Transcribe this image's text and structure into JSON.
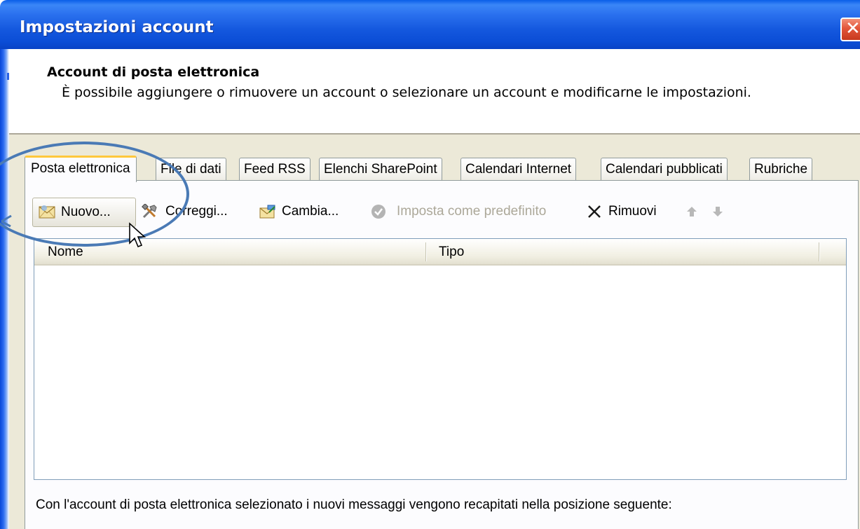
{
  "window": {
    "title": "Impostazioni account",
    "close_label": "✕"
  },
  "header": {
    "title": "Account di posta elettronica",
    "description": "È possibile aggiungere o rimuovere un account o selezionare un account e modificarne le impostazioni."
  },
  "tabs": [
    {
      "label": "Posta elettronica",
      "active": true
    },
    {
      "label": "File di dati",
      "active": false
    },
    {
      "label": "Feed RSS",
      "active": false
    },
    {
      "label": "Elenchi SharePoint",
      "active": false
    },
    {
      "label": "Calendari Internet",
      "active": false
    },
    {
      "label": "Calendari pubblicati",
      "active": false
    },
    {
      "label": "Rubriche",
      "active": false
    }
  ],
  "toolbar": {
    "new_label": "Nuovo...",
    "repair_label": "Correggi...",
    "change_label": "Cambia...",
    "set_default_label": "Imposta come predefinito",
    "remove_label": "Rimuovi",
    "new_icon": "envelope-icon",
    "repair_icon": "tools-icon",
    "change_icon": "change-account-icon",
    "set_default_icon": "check-circle-icon",
    "remove_icon": "x-icon",
    "move_up_icon": "arrow-up-icon",
    "move_down_icon": "arrow-down-icon"
  },
  "list": {
    "columns": [
      "Nome",
      "Tipo"
    ],
    "rows": []
  },
  "footer": {
    "text": "Con l'account di posta elettronica selezionato i nuovi messaggi vengono recapitati nella posizione seguente:"
  },
  "colors": {
    "titlebar": "#0b4dd6",
    "dialog_bg": "#ece9d8",
    "active_tab_accent": "#ffc83c",
    "annotation": "#4a7ab5"
  }
}
